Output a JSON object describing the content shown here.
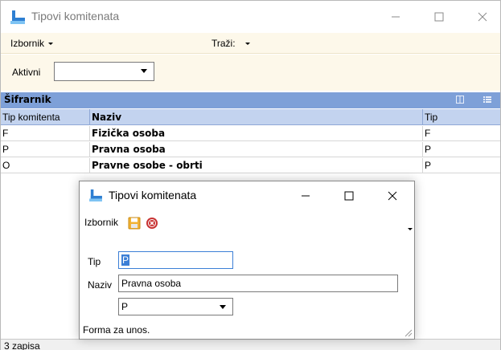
{
  "window": {
    "title": "Tipovi komitenata"
  },
  "menubar": {
    "izbornik": "Izbornik",
    "trazi": "Traži:"
  },
  "filter": {
    "label": "Aktivni",
    "value": ""
  },
  "grid": {
    "title": "Šifrarnik",
    "columns": [
      "Tip komitenta",
      "Naziv",
      "Tip"
    ],
    "rows": [
      {
        "tip_komitenta": "F",
        "naziv": "Fizička osoba",
        "tip": "F"
      },
      {
        "tip_komitenta": "P",
        "naziv": "Pravna osoba",
        "tip": "P"
      },
      {
        "tip_komitenta": "O",
        "naziv": "Pravne osobe - obrti",
        "tip": "P"
      }
    ]
  },
  "status": {
    "record_count": "3 zapisa"
  },
  "dialog": {
    "title": "Tipovi komitenata",
    "menu_label": "Izbornik",
    "fields": {
      "tip_label": "Tip",
      "tip_value": "P",
      "naziv_label": "Naziv",
      "naziv_value": "Pravna osoba",
      "combo_value": "P"
    },
    "status": "Forma za unos."
  },
  "colors": {
    "grid_header": "#7ea0d8",
    "column_header": "#c3d3ef",
    "menubar_bg": "#fdf8ea",
    "save_icon": "#f2b233",
    "cancel_icon": "#c83232",
    "selection": "#3c7fd6"
  },
  "icons": [
    "app-icon",
    "minimize-icon",
    "maximize-icon",
    "close-icon",
    "save-icon",
    "cancel-icon",
    "columns-icon",
    "list-icon",
    "resize-grip-icon"
  ]
}
